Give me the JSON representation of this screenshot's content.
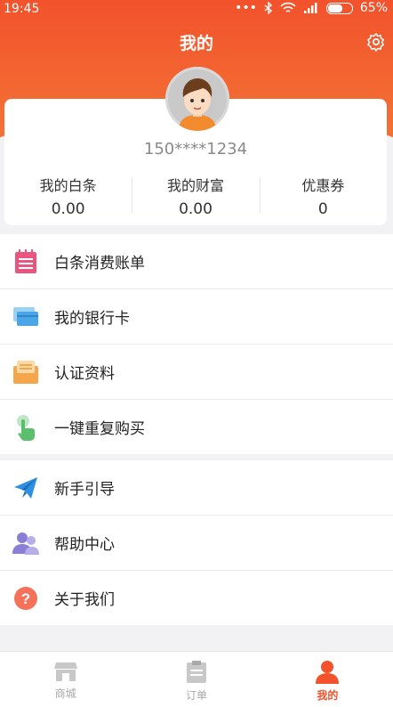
{
  "status": {
    "time": "19:45",
    "battery": "65%"
  },
  "header": {
    "title": "我的"
  },
  "profile": {
    "phone": "150****1234"
  },
  "stats": [
    {
      "label": "我的白条",
      "value": "0.00"
    },
    {
      "label": "我的财富",
      "value": "0.00"
    },
    {
      "label": "优惠券",
      "value": "0"
    }
  ],
  "menu_group1": [
    {
      "label": "白条消费账单",
      "icon": "bill-icon"
    },
    {
      "label": "我的银行卡",
      "icon": "bank-card-icon"
    },
    {
      "label": "认证资料",
      "icon": "document-icon"
    },
    {
      "label": "一键重复购买",
      "icon": "tap-icon"
    }
  ],
  "menu_group2": [
    {
      "label": "新手引导",
      "icon": "paper-plane-icon"
    },
    {
      "label": "帮助中心",
      "icon": "users-icon"
    },
    {
      "label": "关于我们",
      "icon": "question-icon"
    }
  ],
  "tabs": [
    {
      "label": "商城",
      "active": false
    },
    {
      "label": "订单",
      "active": false
    },
    {
      "label": "我的",
      "active": true
    }
  ],
  "colors": {
    "accent": "#f2522c",
    "bill": "#e9557e",
    "card": "#4aa6e6",
    "doc": "#f5a54a",
    "tap": "#5bbf6e",
    "plane": "#2f8fe0",
    "users": "#8a7fd6",
    "about": "#f4725a"
  }
}
